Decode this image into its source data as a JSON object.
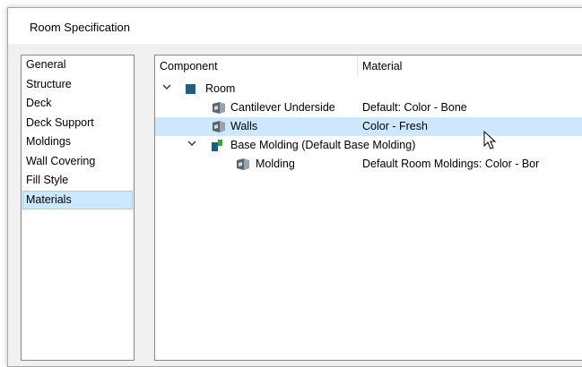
{
  "window": {
    "title": "Room Specification"
  },
  "sidebar": {
    "items": [
      {
        "label": "General"
      },
      {
        "label": "Structure"
      },
      {
        "label": "Deck"
      },
      {
        "label": "Deck Support"
      },
      {
        "label": "Moldings"
      },
      {
        "label": "Wall Covering"
      },
      {
        "label": "Fill Style"
      },
      {
        "label": "Materials",
        "selected": true
      }
    ]
  },
  "tree": {
    "columns": {
      "component": "Component",
      "material": "Material"
    },
    "rows": [
      {
        "component": "Room",
        "material": "",
        "icon": "room-icon",
        "expanded": true
      },
      {
        "component": "Cantilever Underside",
        "material": "Default: Color - Bone",
        "icon": "material-swatch-icon"
      },
      {
        "component": "Walls",
        "material": "Color - Fresh",
        "icon": "material-swatch-icon",
        "selected": true
      },
      {
        "component": "Base Molding (Default Base Molding)",
        "material": "",
        "icon": "molding-icon",
        "expanded": true
      },
      {
        "component": "Molding",
        "material": "Default Room Moldings: Color - Bor",
        "icon": "material-swatch-icon"
      }
    ]
  },
  "colors": {
    "selection_bg": "#cce8ff",
    "selection_border": "#99d1ff",
    "room_icon": "#1b5e86",
    "molding_icon_green": "#3fa535"
  },
  "icons": {
    "expand": "chevron-down-icon",
    "pointer": "mouse-cursor-icon"
  }
}
